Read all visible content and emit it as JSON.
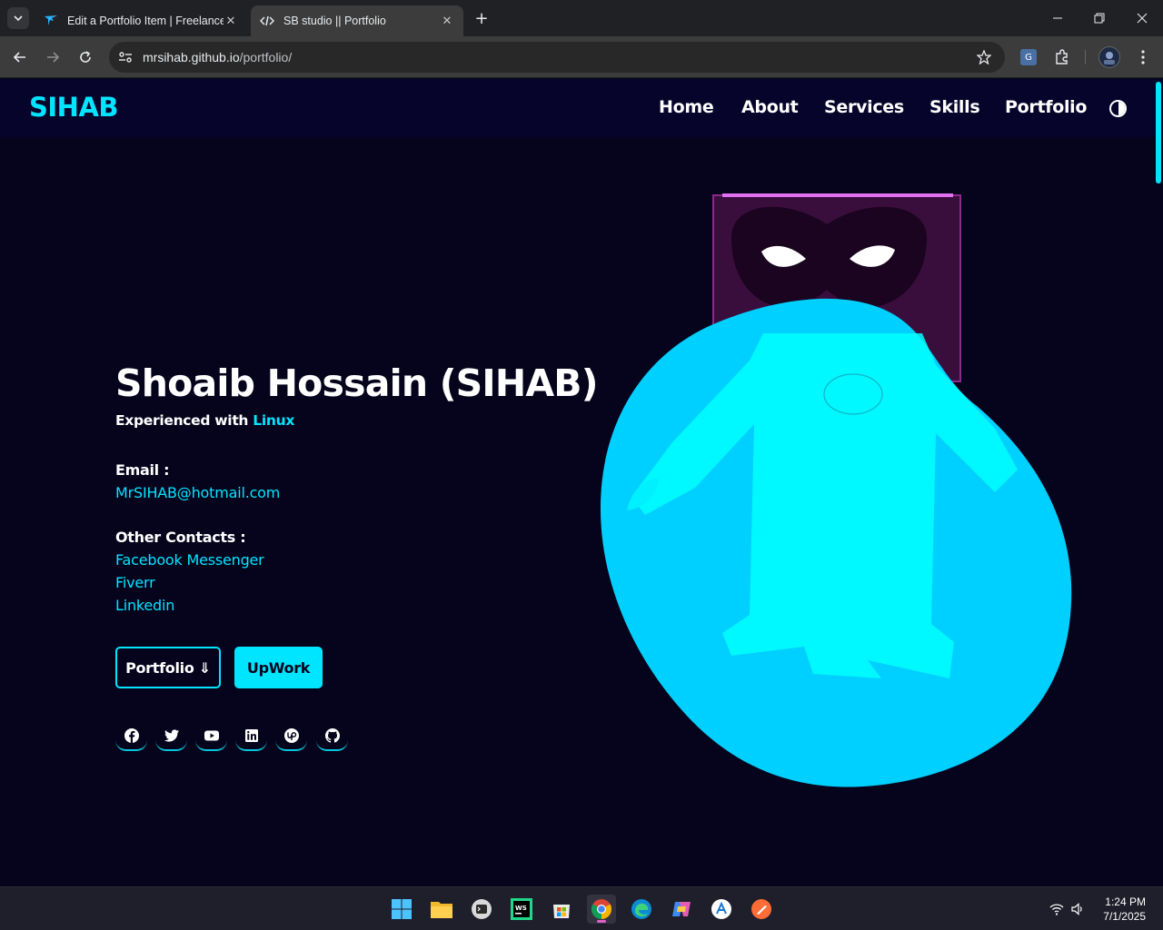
{
  "browser": {
    "tabs": [
      {
        "title": "Edit a Portfolio Item | Freelancer",
        "favicon": "freelancer-bird-icon",
        "active": false
      },
      {
        "title": "SB studio || Portfolio",
        "favicon": "code-icon",
        "active": true
      }
    ],
    "url_host": "mrsihab.github.io",
    "url_path": "/portfolio/",
    "accent_color": "#3c3c3c"
  },
  "site": {
    "logo": "SIHAB",
    "nav": [
      "Home",
      "About",
      "Services",
      "Skills",
      "Portfolio"
    ],
    "accent": "#00e5ff",
    "background": "#05041c"
  },
  "hero": {
    "name": "Shoaib Hossain (SIHAB)",
    "subtitle_prefix": "Experienced with",
    "subtitle_accent": "Linux",
    "email_label": "Email :",
    "email": "MrSIHAB@hotmail.com",
    "contacts_label": "Other Contacts :",
    "contacts": [
      "Facebook Messenger",
      "Fiverr",
      "Linkedin"
    ],
    "buttons": {
      "portfolio": "Portfolio ⇓",
      "upwork": "UpWork"
    },
    "socials": [
      "facebook-icon",
      "twitter-icon",
      "youtube-icon",
      "linkedin-icon",
      "upwork-icon",
      "github-icon"
    ]
  },
  "taskbar": {
    "apps": [
      "windows-start-icon",
      "file-explorer-icon",
      "terminal-icon",
      "webstorm-icon",
      "microsoft-store-icon",
      "chrome-icon",
      "edge-icon",
      "copilot-icon",
      "app-store-icon",
      "postman-icon"
    ],
    "time": "1:24 PM",
    "date": "7/1/2025"
  }
}
